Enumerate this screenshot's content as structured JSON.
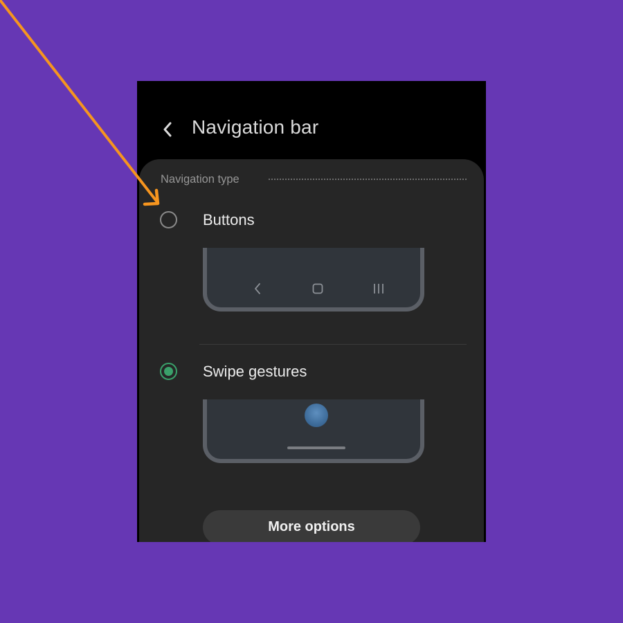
{
  "header": {
    "title": "Navigation bar",
    "back_icon": "chevron-left-icon"
  },
  "section": {
    "label": "Navigation type"
  },
  "options": [
    {
      "label": "Buttons",
      "selected": false,
      "preview_icons": [
        "chevron-left-icon",
        "home-square-icon",
        "recents-lines-icon"
      ]
    },
    {
      "label": "Swipe gestures",
      "selected": true,
      "preview_icons": [
        "gesture-ball-icon",
        "gesture-handle-icon"
      ]
    }
  ],
  "more_options": {
    "label": "More options"
  },
  "annotation": {
    "type": "arrow",
    "color": "#f6951f",
    "points_to": "Buttons radio"
  },
  "colors": {
    "background": "#6637b4",
    "screen": "#000000",
    "panel": "#262626",
    "accent": "#3aa06a",
    "preview_fill": "#30353b",
    "preview_border": "#5b5f66",
    "arrow": "#f6951f"
  }
}
